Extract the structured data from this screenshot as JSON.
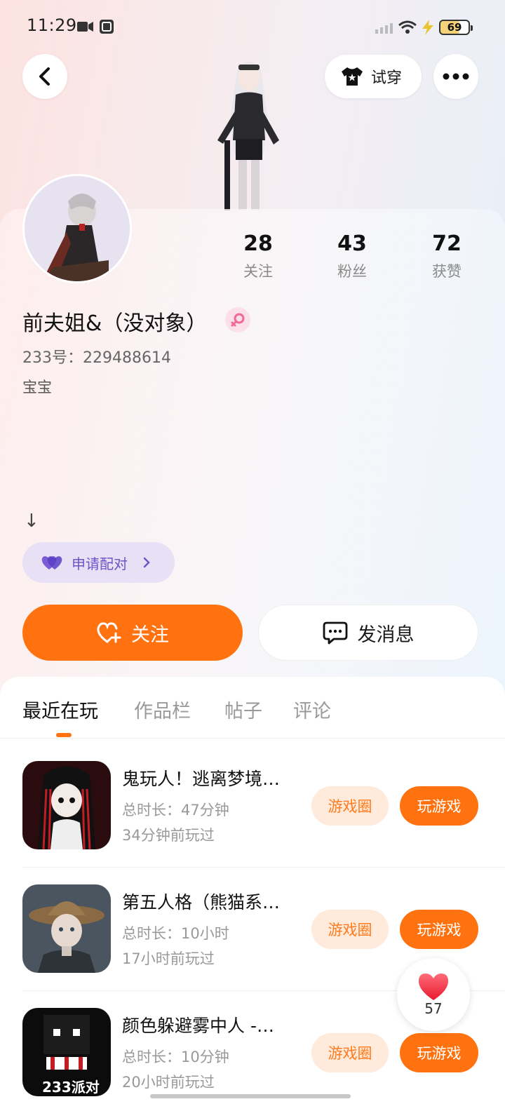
{
  "status_bar": {
    "time": "11:29",
    "battery": "69"
  },
  "header": {
    "try_on_label": "试穿"
  },
  "profile": {
    "stats": [
      {
        "num": "28",
        "label": "关注"
      },
      {
        "num": "43",
        "label": "粉丝"
      },
      {
        "num": "72",
        "label": "获赞"
      }
    ],
    "username": "前夫姐&（没对象）",
    "uid": "233号：229488614",
    "bio": "宝宝",
    "arrow": "↓",
    "pair_label": "申请配对",
    "follow_label": "关注",
    "message_label": "发消息"
  },
  "tabs": [
    {
      "label": "最近在玩",
      "active": true
    },
    {
      "label": "作品栏",
      "active": false
    },
    {
      "label": "帖子",
      "active": false
    },
    {
      "label": "评论",
      "active": false
    }
  ],
  "games": [
    {
      "title": "鬼玩人！逃离梦境…",
      "duration": "总时长：47分钟",
      "last_played": "34分钟前玩过",
      "circle_label": "游戏圈",
      "play_label": "玩游戏"
    },
    {
      "title": "第五人格（熊猫系…",
      "duration": "总时长：10小时",
      "last_played": "17小时前玩过",
      "circle_label": "游戏圈",
      "play_label": "玩游戏"
    },
    {
      "title": "颜色躲避雾中人 -…",
      "duration": "总时长：10分钟",
      "last_played": "20小时前玩过",
      "circle_label": "游戏圈",
      "play_label": "玩游戏",
      "thumb_text": "233派对"
    }
  ],
  "like_float": {
    "count": "57"
  },
  "colors": {
    "accent": "#ff720f",
    "accent_soft": "#ffeadb",
    "pair_purple": "#6e53c8"
  }
}
